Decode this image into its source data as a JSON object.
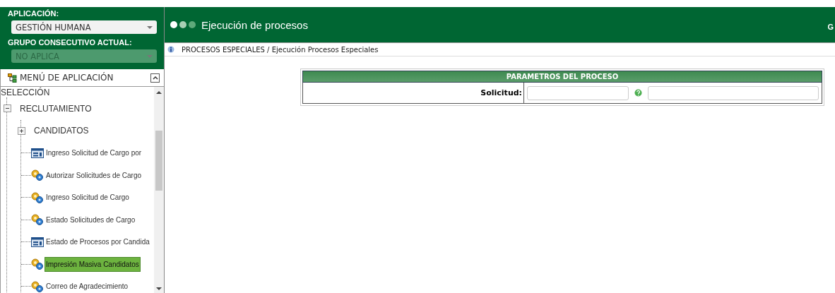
{
  "sidebar": {
    "application_label": "APLICACIÓN:",
    "application": "GESTIÓN HUMANA",
    "group_label": "GRUPO CONSECUTIVO ACTUAL:",
    "group": "NO APLICA",
    "group_disabled": true,
    "menu_title": "MENÚ DE APLICACIÓN",
    "tree": [
      {
        "label": "SELECCIÓN",
        "kind": "root",
        "children": [
          {
            "label": "RECLUTAMIENTO",
            "kind": "folder",
            "expanded": true,
            "children": [
              {
                "label": "CANDIDATOS",
                "kind": "folder",
                "expanded": false
              },
              {
                "label": "Ingreso Solicitud de Cargo por",
                "kind": "form",
                "selected": false
              },
              {
                "label": "Autorizar Solicitudes de Cargo",
                "kind": "process",
                "selected": false
              },
              {
                "label": "Ingreso Solicitud de Cargo",
                "kind": "process",
                "selected": false
              },
              {
                "label": "Estado Solicitudes de Cargo",
                "kind": "process",
                "selected": false
              },
              {
                "label": "Estado de Procesos por Candida",
                "kind": "form",
                "selected": false
              },
              {
                "label": "Impresión Masiva Candidatos",
                "kind": "process",
                "selected": true
              },
              {
                "label": "Correo de Agradecimiento",
                "kind": "process",
                "selected": false
              }
            ]
          }
        ]
      }
    ]
  },
  "header": {
    "title": "Ejecución de procesos",
    "user": "G"
  },
  "breadcrumb": "PROCESOS ESPECIALES / Ejecución Procesos Especiales",
  "parameters": {
    "title": "PARAMETROS DEL PROCESO",
    "fields": [
      {
        "label": "Solicitud:"
      }
    ]
  }
}
